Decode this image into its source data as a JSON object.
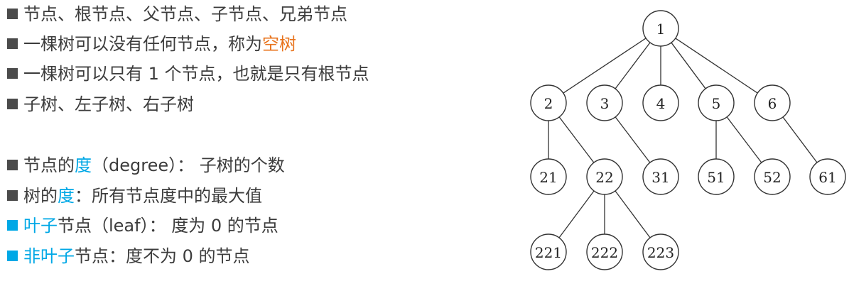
{
  "bullets": [
    {
      "parts": [
        {
          "text": "节点、根节点、父节点、子节点、兄弟节点",
          "style": "normal"
        }
      ],
      "bullet": "gray"
    },
    {
      "parts": [
        {
          "text": "一棵树可以没有任何节点，称为",
          "style": "normal"
        },
        {
          "text": "空树",
          "style": "orange"
        }
      ],
      "bullet": "gray"
    },
    {
      "parts": [
        {
          "text": "一棵树可以只有 1 个节点，也就是只有根节点",
          "style": "normal"
        }
      ],
      "bullet": "gray"
    },
    {
      "parts": [
        {
          "text": "子树、左子树、右子树",
          "style": "normal"
        }
      ],
      "bullet": "gray"
    },
    {
      "parts": [
        {
          "text": "节点的",
          "style": "normal"
        },
        {
          "text": "度",
          "style": "blue"
        },
        {
          "text": "（degree）： 子树的个数",
          "style": "normal"
        }
      ],
      "bullet": "gray"
    },
    {
      "parts": [
        {
          "text": "树的",
          "style": "normal"
        },
        {
          "text": "度",
          "style": "blue"
        },
        {
          "text": "：所有节点度中的最大值",
          "style": "normal"
        }
      ],
      "bullet": "gray"
    },
    {
      "parts": [
        {
          "text": "叶子",
          "style": "blue"
        },
        {
          "text": "节点（leaf）： 度为 0 的节点",
          "style": "normal"
        }
      ],
      "bullet": "blue"
    },
    {
      "parts": [
        {
          "text": "非叶子",
          "style": "blue"
        },
        {
          "text": "节点：度不为 0 的节点",
          "style": "normal"
        }
      ],
      "bullet": "blue"
    }
  ],
  "colors": {
    "accent_blue": "#00a8e6",
    "accent_orange": "#e8731c",
    "text": "#3c3c3c"
  },
  "tree": {
    "nodes": [
      {
        "id": "1",
        "label": "1",
        "children": [
          "2",
          "3",
          "4",
          "5",
          "6"
        ]
      },
      {
        "id": "2",
        "label": "2",
        "children": [
          "21",
          "22"
        ]
      },
      {
        "id": "3",
        "label": "3",
        "children": [
          "31"
        ]
      },
      {
        "id": "4",
        "label": "4",
        "children": []
      },
      {
        "id": "5",
        "label": "5",
        "children": [
          "51",
          "52"
        ]
      },
      {
        "id": "6",
        "label": "6",
        "children": [
          "61"
        ]
      },
      {
        "id": "21",
        "label": "21",
        "children": []
      },
      {
        "id": "22",
        "label": "22",
        "children": [
          "221",
          "222",
          "223"
        ]
      },
      {
        "id": "31",
        "label": "31",
        "children": []
      },
      {
        "id": "51",
        "label": "51",
        "children": []
      },
      {
        "id": "52",
        "label": "52",
        "children": []
      },
      {
        "id": "61",
        "label": "61",
        "children": []
      },
      {
        "id": "221",
        "label": "221",
        "children": []
      },
      {
        "id": "222",
        "label": "222",
        "children": []
      },
      {
        "id": "223",
        "label": "223",
        "children": []
      }
    ]
  }
}
